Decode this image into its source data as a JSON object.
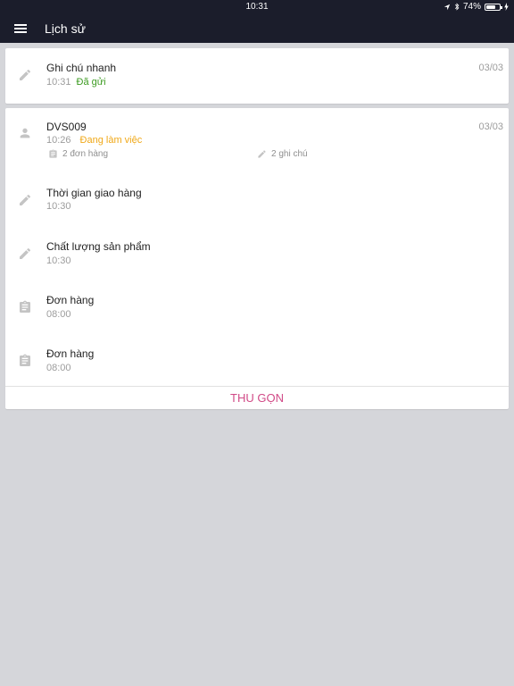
{
  "status_bar": {
    "time": "10:31",
    "battery": "74%",
    "battery_level": 0.74
  },
  "header": {
    "title": "Lịch sử"
  },
  "quick_note": {
    "title": "Ghi chú nhanh",
    "time": "10:31",
    "status": "Đã gửi",
    "date": "03/03",
    "status_color": "#3a9a1f"
  },
  "visit": {
    "name": "DVS009",
    "time": "10:26",
    "status": "Đang làm việc",
    "date": "03/03",
    "status_color": "#f0a818",
    "orders_count": "2 đơn hàng",
    "notes_count": "2 ghi chú",
    "items": [
      {
        "icon": "pencil-icon",
        "title": "Thời gian giao hàng",
        "time": "10:30"
      },
      {
        "icon": "pencil-icon",
        "title": "Chất lượng sản phẩm",
        "time": "10:30"
      },
      {
        "icon": "clipboard-icon",
        "title": "Đơn hàng",
        "time": "08:00"
      },
      {
        "icon": "clipboard-icon",
        "title": "Đơn hàng",
        "time": "08:00"
      }
    ],
    "collapse_label": "THU GỌN"
  },
  "colors": {
    "app_bar": "#1b1d2b",
    "background": "#d5d6da",
    "accent": "#d14a87",
    "icon_gray": "#c4c4c4"
  }
}
